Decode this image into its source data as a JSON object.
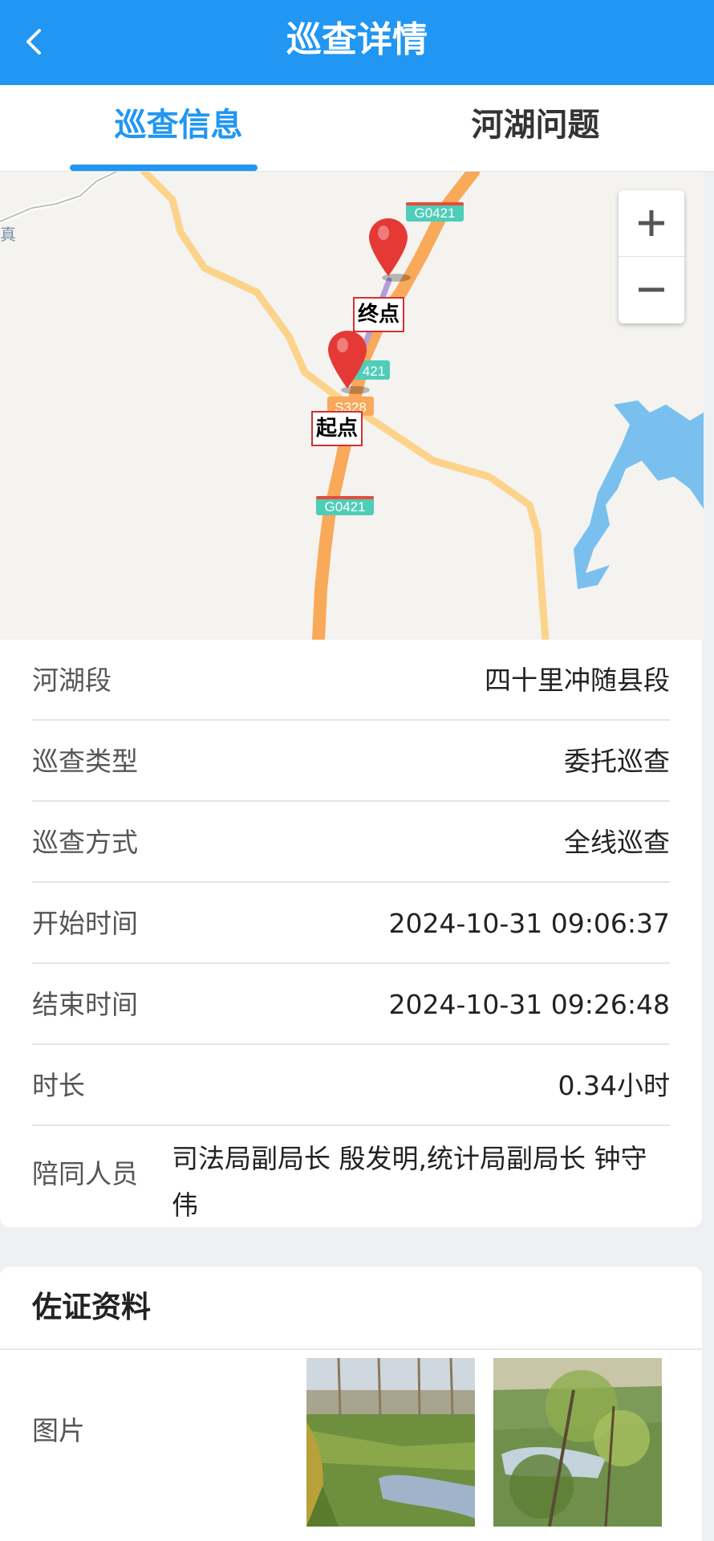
{
  "header": {
    "title": "巡查详情",
    "back_icon": "chevron-left-icon"
  },
  "tabs": [
    {
      "label": "巡查信息",
      "active": true
    },
    {
      "label": "河湖问题",
      "active": false
    }
  ],
  "map": {
    "road_labels": [
      "G0421",
      "421",
      "S328",
      "G0421"
    ],
    "edge_label": "真",
    "markers": {
      "end": "终点",
      "start": "起点"
    },
    "zoom_in": "+",
    "zoom_out": "−"
  },
  "info": {
    "river_section": {
      "label": "河湖段",
      "value": "四十里冲随县段"
    },
    "patrol_type": {
      "label": "巡查类型",
      "value": "委托巡查"
    },
    "patrol_method": {
      "label": "巡查方式",
      "value": "全线巡查"
    },
    "start_time": {
      "label": "开始时间",
      "value": "2024-10-31 09:06:37"
    },
    "end_time": {
      "label": "结束时间",
      "value": "2024-10-31 09:26:48"
    },
    "duration": {
      "label": "时长",
      "value": "0.34小时"
    },
    "companions": {
      "label": "陪同人员",
      "value": "司法局副局长 殷发明,统计局副局长 钟守伟"
    }
  },
  "evidence": {
    "title": "佐证资料",
    "photo_label": "图片"
  },
  "colors": {
    "primary": "#2196f3",
    "marker": "#e53935",
    "road": "#f9a95a",
    "water": "#79c0ef"
  }
}
